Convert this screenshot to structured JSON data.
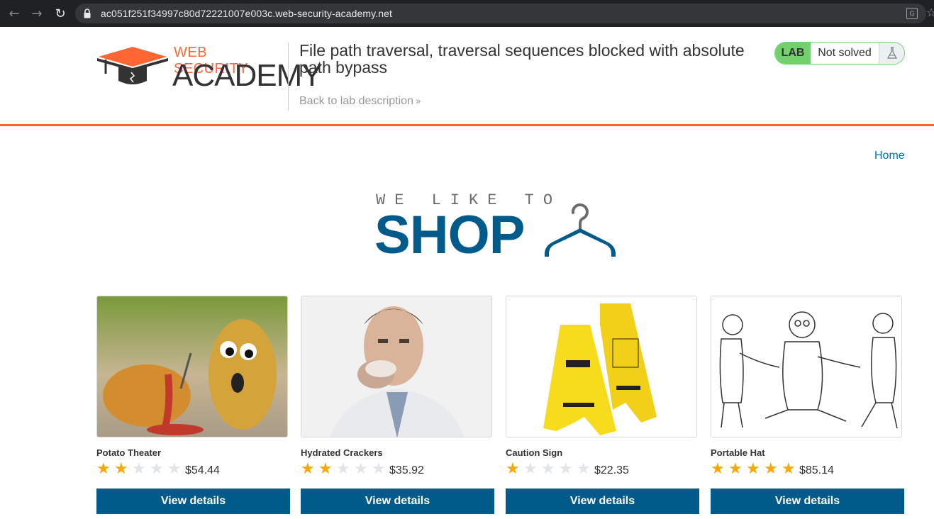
{
  "browser": {
    "url": "ac051f251f34997c80d72221007e003c.web-security-academy.net"
  },
  "header": {
    "logo_top": "WEB SECURITY",
    "logo_bottom": "ACADEMY",
    "lab_title": "File path traversal, traversal sequences blocked with absolute path bypass",
    "back_link": "Back to lab description",
    "lab_badge": "LAB",
    "lab_state": "Not solved"
  },
  "nav": {
    "home": "Home"
  },
  "banner": {
    "small": "WE LIKE TO",
    "big": "SHOP"
  },
  "colors": {
    "accent_orange": "#ff6633",
    "brand_blue": "#005b8a",
    "lab_green": "#70d16d",
    "star_on": "#f7a707"
  },
  "products": [
    {
      "name": "Potato Theater",
      "rating": 2,
      "price": "$54.44",
      "button": "View details",
      "image": "potato-image"
    },
    {
      "name": "Hydrated Crackers",
      "rating": 2,
      "price": "$35.92",
      "button": "View details",
      "image": "crackers-image"
    },
    {
      "name": "Caution Sign",
      "rating": 1,
      "price": "$22.35",
      "button": "View details",
      "image": "caution-sign-image"
    },
    {
      "name": "Portable Hat",
      "rating": 5,
      "price": "$85.14",
      "button": "View details",
      "image": "sketch-image"
    }
  ]
}
